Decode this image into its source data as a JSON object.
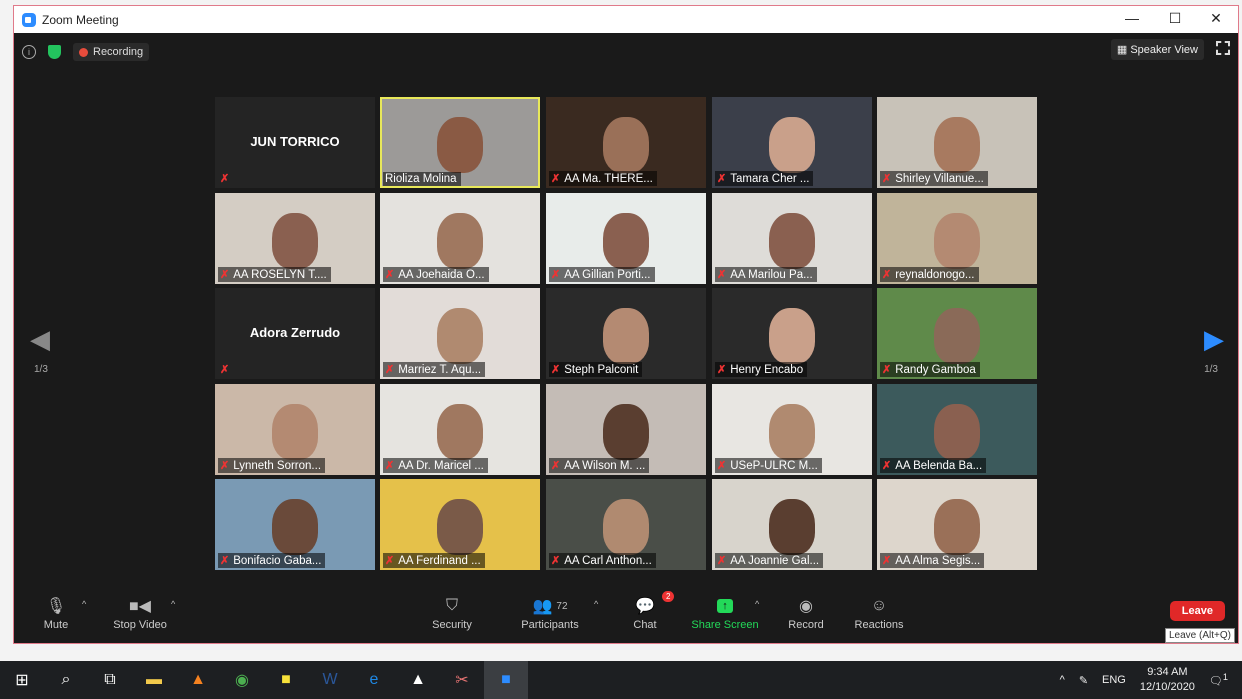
{
  "window": {
    "title": "Zoom Meeting",
    "minimize": "—",
    "maximize": "☐",
    "close": "✕"
  },
  "topbar": {
    "info": "i",
    "recording": "Recording",
    "speaker_view": "Speaker View"
  },
  "nav": {
    "prev_page": "1/3",
    "next_page": "1/3"
  },
  "participants": [
    {
      "name": "JUN TORRICO",
      "video": false
    },
    {
      "name": "Rioliza Molina",
      "video": true,
      "active": true,
      "muted": false
    },
    {
      "name": "AA Ma. THERE...",
      "video": true
    },
    {
      "name": "Tamara Cher ...",
      "video": true
    },
    {
      "name": "Shirley Villanue...",
      "video": true
    },
    {
      "name": "AA ROSELYN T....",
      "video": true
    },
    {
      "name": "AA Joehaida O...",
      "video": true
    },
    {
      "name": "AA Gillian Porti...",
      "video": true
    },
    {
      "name": "AA Marilou Pa...",
      "video": true
    },
    {
      "name": "reynaldonogo...",
      "video": true
    },
    {
      "name": "Adora Zerrudo",
      "video": false
    },
    {
      "name": "Marriez T. Aqu...",
      "video": true
    },
    {
      "name": "Steph Palconit",
      "video": true
    },
    {
      "name": "Henry Encabo",
      "video": true
    },
    {
      "name": "Randy Gamboa",
      "video": true
    },
    {
      "name": "Lynneth Sorron...",
      "video": true
    },
    {
      "name": "AA Dr. Maricel ...",
      "video": true
    },
    {
      "name": "AA Wilson M. ...",
      "video": true
    },
    {
      "name": "USeP-ULRC M...",
      "video": true
    },
    {
      "name": "AA Belenda Ba...",
      "video": true
    },
    {
      "name": "Bonifacio Gaba...",
      "video": true
    },
    {
      "name": "AA Ferdinand ...",
      "video": true
    },
    {
      "name": "AA Carl Anthon...",
      "video": true
    },
    {
      "name": "AA Joannie Gal...",
      "video": true
    },
    {
      "name": "AA Alma Segis...",
      "video": true
    }
  ],
  "toolbar": {
    "mute": "Mute",
    "stop_video": "Stop Video",
    "security": "Security",
    "participants": "Participants",
    "participant_count": "72",
    "chat": "Chat",
    "chat_badge": "2",
    "share_screen": "Share Screen",
    "record": "Record",
    "reactions": "Reactions",
    "leave": "Leave",
    "leave_tooltip": "Leave (Alt+Q)"
  },
  "taskbar": {
    "lang": "ENG",
    "time": "9:34 AM",
    "date": "12/10/2020",
    "notifications": "1"
  },
  "colors": {
    "share_green": "#23d959",
    "leave_red": "#e02828",
    "active_speaker": "#e8e85a"
  }
}
